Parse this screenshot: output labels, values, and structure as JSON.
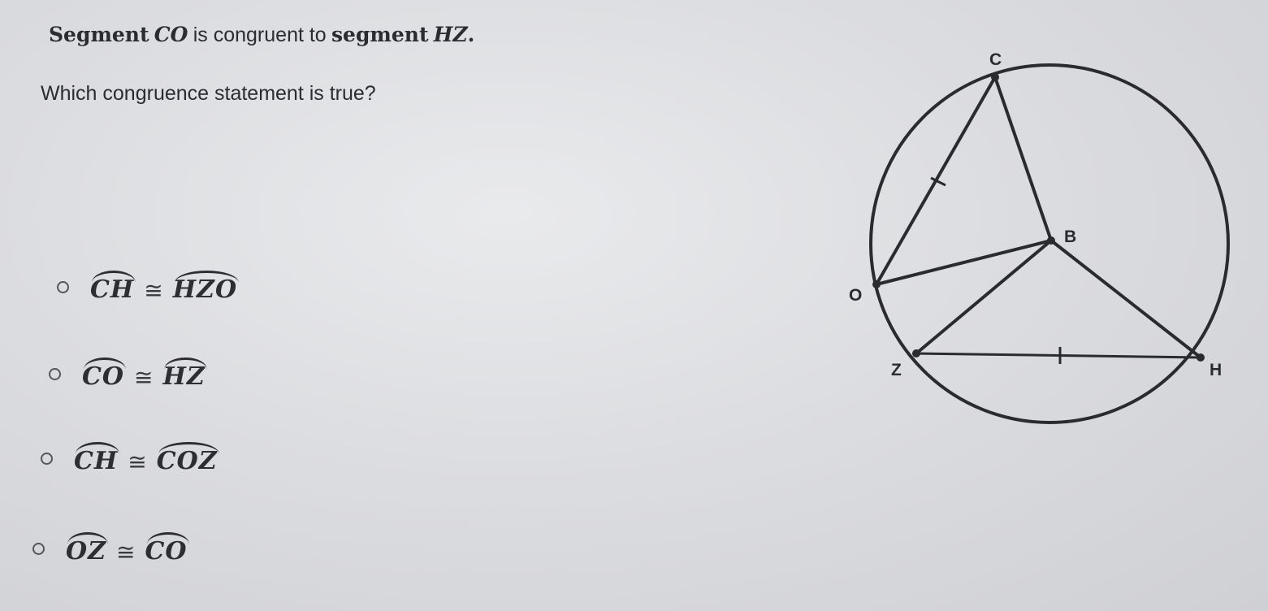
{
  "question": {
    "line1_prefix": "Segment",
    "segment1": "CO",
    "line1_middle": "is congruent to",
    "line1_segment_word": "segment",
    "segment2": "HZ",
    "line1_end": ".",
    "prompt": "Which congruence statement is true?"
  },
  "options": [
    {
      "left_arc": "CH",
      "symbol": "≅",
      "right_arc": "HZO",
      "selected": false
    },
    {
      "left_arc": "CO",
      "symbol": "≅",
      "right_arc": "HZ",
      "selected": false
    },
    {
      "left_arc": "CH",
      "symbol": "≅",
      "right_arc": "COZ",
      "selected": false
    },
    {
      "left_arc": "OZ",
      "symbol": "≅",
      "right_arc": "CO",
      "selected": false
    }
  ],
  "diagram": {
    "center_point": "B",
    "points_on_circle": [
      "C",
      "O",
      "Z",
      "H"
    ],
    "labels": {
      "C": "C",
      "B": "B",
      "O": "O",
      "Z": "Z",
      "H": "H"
    },
    "segments": [
      "CO",
      "CB",
      "OB",
      "ZB",
      "HB",
      "ZH"
    ],
    "tick_marks_on": [
      "CO",
      "ZH"
    ]
  }
}
